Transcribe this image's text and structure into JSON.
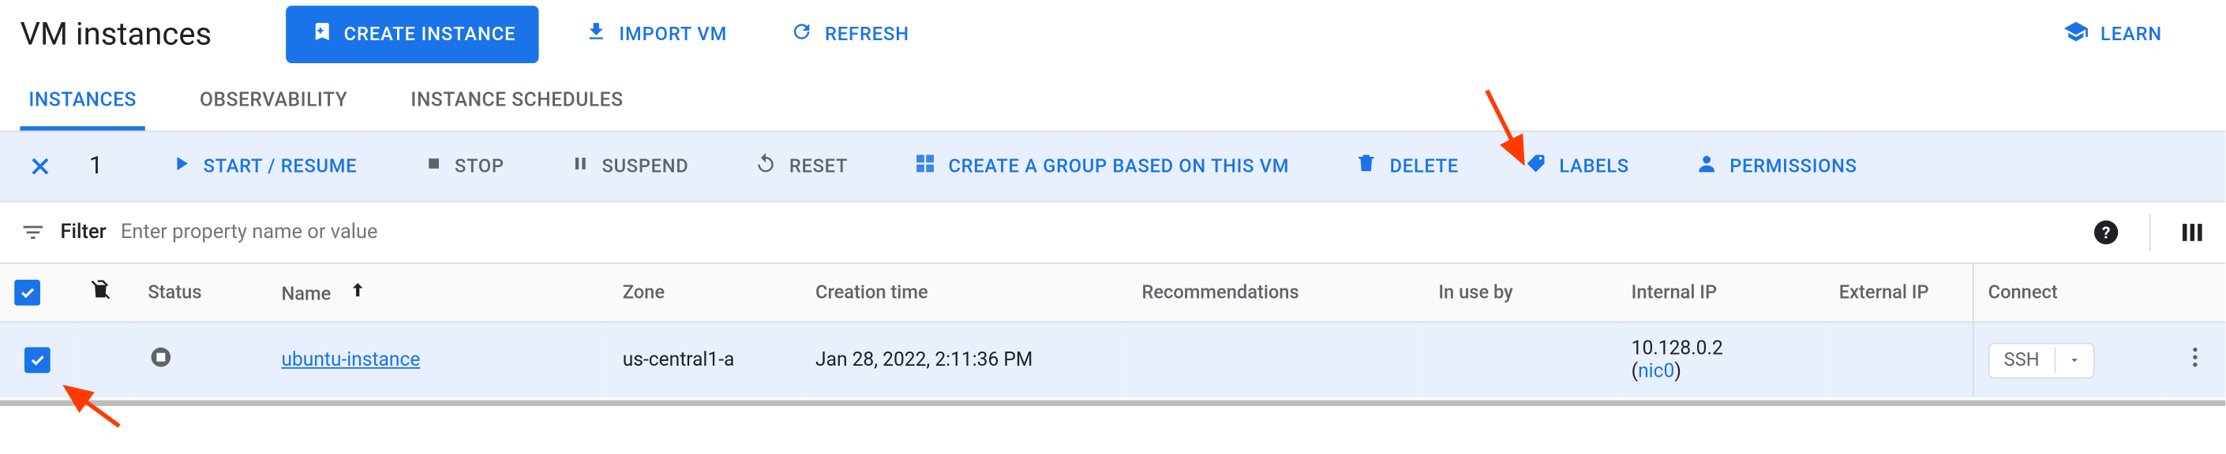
{
  "header": {
    "title": "VM instances",
    "create_label": "CREATE INSTANCE",
    "import_label": "IMPORT VM",
    "refresh_label": "REFRESH",
    "learn_label": "LEARN"
  },
  "tabs": {
    "instances": "INSTANCES",
    "observability": "OBSERVABILITY",
    "schedules": "INSTANCE SCHEDULES"
  },
  "actionbar": {
    "selected_count": "1",
    "start": "START / RESUME",
    "stop": "STOP",
    "suspend": "SUSPEND",
    "reset": "RESET",
    "group": "CREATE A GROUP BASED ON THIS VM",
    "delete": "DELETE",
    "labels": "LABELS",
    "permissions": "PERMISSIONS"
  },
  "filter": {
    "label": "Filter",
    "placeholder": "Enter property name or value"
  },
  "table": {
    "headers": {
      "status": "Status",
      "name": "Name",
      "zone": "Zone",
      "ctime": "Creation time",
      "rec": "Recommendations",
      "inuse": "In use by",
      "intip": "Internal IP",
      "extip": "External IP",
      "connect": "Connect"
    },
    "rows": [
      {
        "checked": true,
        "name": "ubuntu-instance",
        "zone": "us-central1-a",
        "ctime": "Jan 28, 2022, 2:11:36 PM",
        "rec": "",
        "inuse": "",
        "intip": "10.128.0.2",
        "nic": "nic0",
        "extip": "",
        "ssh": "SSH"
      }
    ]
  }
}
